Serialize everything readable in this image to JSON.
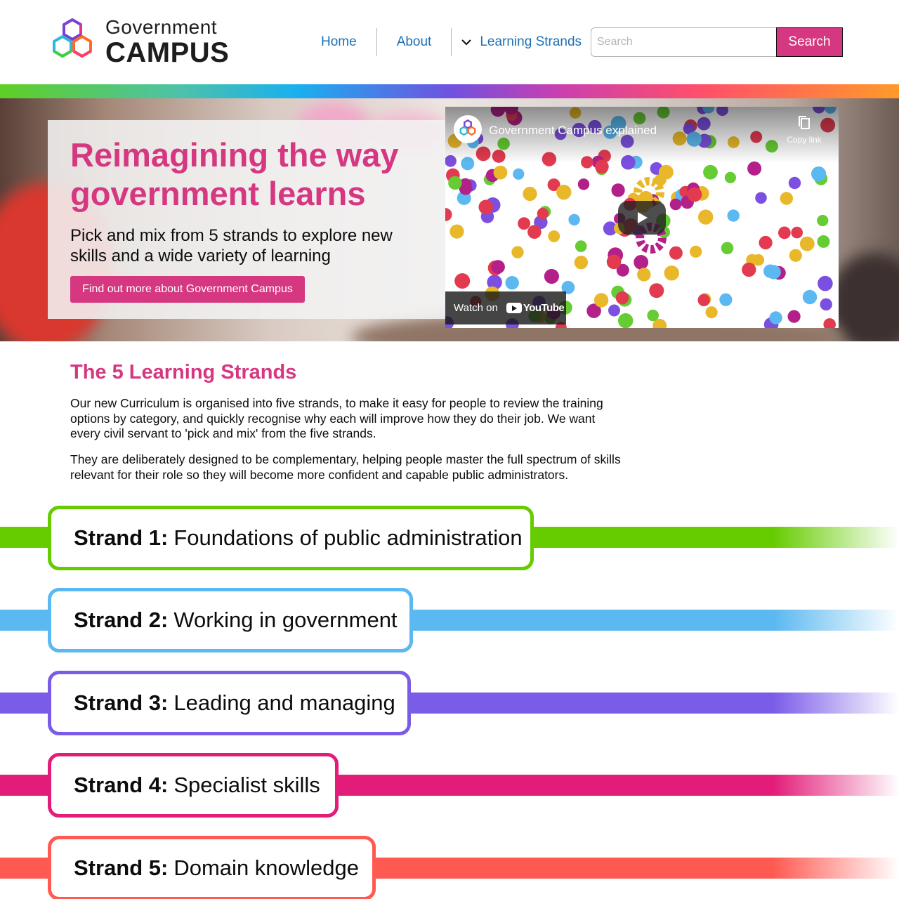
{
  "header": {
    "logo": {
      "line1": "Government",
      "line2": "CAMPUS"
    },
    "nav": [
      {
        "label": "Home"
      },
      {
        "label": "About"
      },
      {
        "label": "Learning Strands",
        "icon": "chevron-down-icon"
      }
    ],
    "search": {
      "placeholder": "Search",
      "value": "",
      "button_label": "Search"
    }
  },
  "hero": {
    "title": "Reimagining the way government learns",
    "subtitle": "Pick and mix from 5 strands to explore new skills and a wide variety of learning",
    "button_label": "Find out more about Government Campus",
    "video": {
      "title": "Government Campus explained",
      "copy_label": "Copy link",
      "watch_label": "Watch on",
      "platform": "YouTube"
    }
  },
  "main": {
    "heading": "The 5 Learning Strands",
    "paragraphs": [
      "Our new Curriculum is organised into five strands, to make it easy for people to review the training options by category, and quickly recognise why each will improve how they do their job. We want every civil servant to 'pick and mix' from the five strands.",
      "They are deliberately designed to be complementary, helping people master the full spectrum of skills relevant for their role so they will become more confident and capable public administrators."
    ],
    "strands": [
      {
        "prefix": "Strand 1:",
        "title": "Foundations of public administration",
        "color": "#66cc00"
      },
      {
        "prefix": "Strand 2:",
        "title": "Working in government",
        "color": "#5bb8f0"
      },
      {
        "prefix": "Strand 3:",
        "title": "Leading and managing",
        "color": "#7b5ce8"
      },
      {
        "prefix": "Strand 4:",
        "title": "Specialist skills",
        "color": "#e31c79"
      },
      {
        "prefix": "Strand 5:",
        "title": "Domain knowledge",
        "color": "#ff5a52"
      }
    ]
  },
  "colors": {
    "brand_pink": "#d53880",
    "link_blue": "#1d70b8"
  }
}
